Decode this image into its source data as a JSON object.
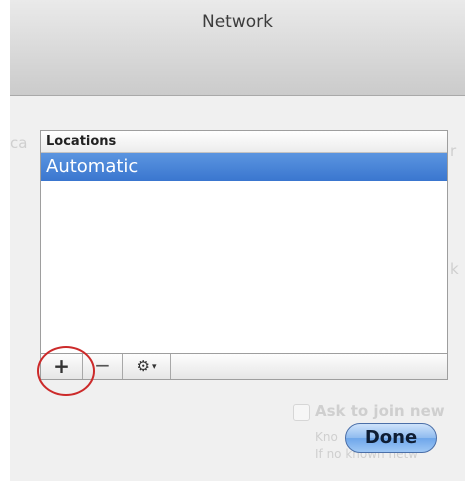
{
  "window": {
    "title": "Network"
  },
  "background": {
    "left_fragment": "ca",
    "right_fragment_1": "r",
    "right_fragment_2": "k",
    "checkbox_label": "Ask to join new",
    "help_line_1": "Kno",
    "help_line_2": "If no known netw"
  },
  "locations_sheet": {
    "header": "Locations",
    "items": [
      {
        "label": "Automatic",
        "selected": true
      }
    ],
    "toolbar": {
      "add_label": "+",
      "remove_label": "−",
      "gear_icon": "gear-icon",
      "gear_glyph": "⚙",
      "caret_glyph": "▾"
    },
    "done_label": "Done"
  },
  "colors": {
    "selection": "#3a76cf",
    "highlight_circle": "#cc2a2a"
  }
}
